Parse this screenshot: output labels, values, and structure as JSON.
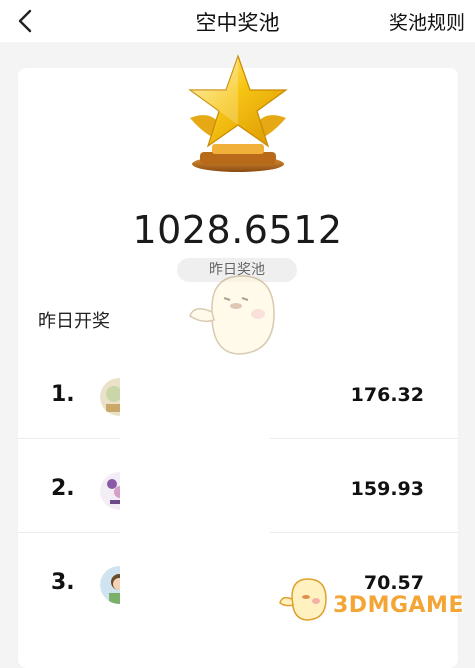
{
  "header": {
    "back_icon": "chevron-left-icon",
    "title": "空中奖池",
    "rules_label": "奖池规则"
  },
  "pool": {
    "trophy_icon": "gold-star-trophy-icon",
    "amount": "1028.6512",
    "tag": "昨日奖池"
  },
  "section": {
    "title": "昨日开奖"
  },
  "ranking": [
    {
      "rank": "1.",
      "value": "176.32"
    },
    {
      "rank": "2.",
      "value": "159.93"
    },
    {
      "rank": "3.",
      "value": "70.57"
    }
  ],
  "watermark": {
    "text": "3DMGAME",
    "color": "#f3a636"
  },
  "colors": {
    "star_gold": "#f7c514",
    "base_bronze": "#b86a1a",
    "background": "#f4f4f4"
  }
}
